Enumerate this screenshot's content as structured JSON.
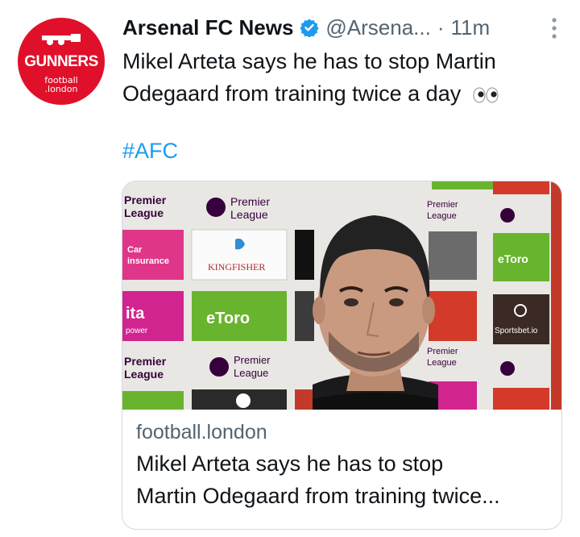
{
  "account": {
    "name": "Arsenal FC News",
    "handle": "@Arsena...",
    "separator": "·",
    "time": "11m",
    "avatar_text": "GUNNERS",
    "avatar_sub_line1": "football",
    "avatar_sub_line2": ".london"
  },
  "tweet": {
    "text": "Mikel Arteta says he has to stop Martin Odegaard from training twice a day",
    "emoji": "eyes-emoji",
    "hashtag": "#AFC"
  },
  "card": {
    "domain": "football.london",
    "title_line1": "Mikel Arteta says he has to stop",
    "title_line2": "Martin Odegaard from training twice...",
    "board_texts": {
      "premier": "Premier",
      "league": "League",
      "car": "Car",
      "insurance": "insurance",
      "kingfisher": "KINGFISHER",
      "etoro": "eToro",
      "ita": "ita",
      "power": "power",
      "sportsbet": "Sportsbet.io"
    }
  },
  "colors": {
    "accent": "#1d9bf0",
    "avatar_bg": "#e0102a",
    "text": "#0f1419",
    "secondary": "#536471"
  }
}
